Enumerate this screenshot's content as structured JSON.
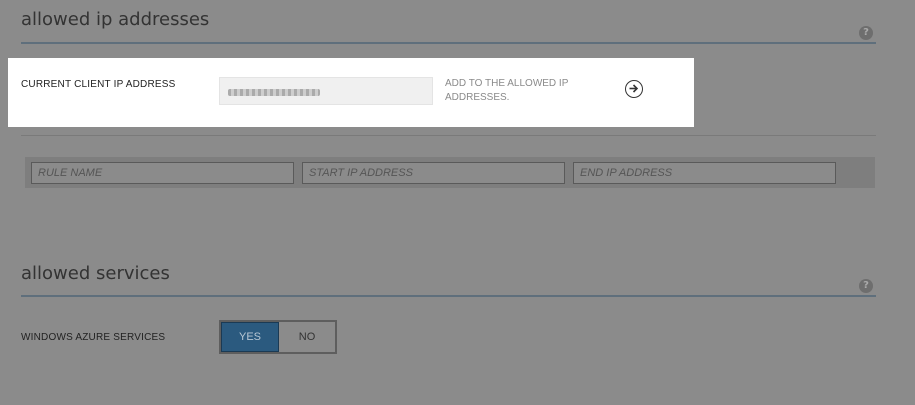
{
  "sections": {
    "allowed_ip": {
      "title": "allowed ip addresses",
      "help_icon": "?"
    },
    "allowed_services": {
      "title": "allowed services",
      "help_icon": "?"
    }
  },
  "current_client": {
    "label": "CURRENT CLIENT IP ADDRESS",
    "ip_value": "",
    "add_text": "ADD TO THE ALLOWED IP ADDRESSES.",
    "arrow_icon": "circle-arrow-right-icon"
  },
  "rule_inputs": {
    "rule_name_placeholder": "RULE NAME",
    "start_ip_placeholder": "START IP ADDRESS",
    "end_ip_placeholder": "END IP ADDRESS"
  },
  "services": {
    "windows_azure_label": "WINDOWS AZURE SERVICES",
    "yes_label": "YES",
    "no_label": "NO",
    "selected": "YES"
  },
  "colors": {
    "overlay": "#8b8b8b",
    "highlight": "#ffffff",
    "yes_active": "#2b5a7f",
    "rule_line": "#5f6f7c"
  }
}
